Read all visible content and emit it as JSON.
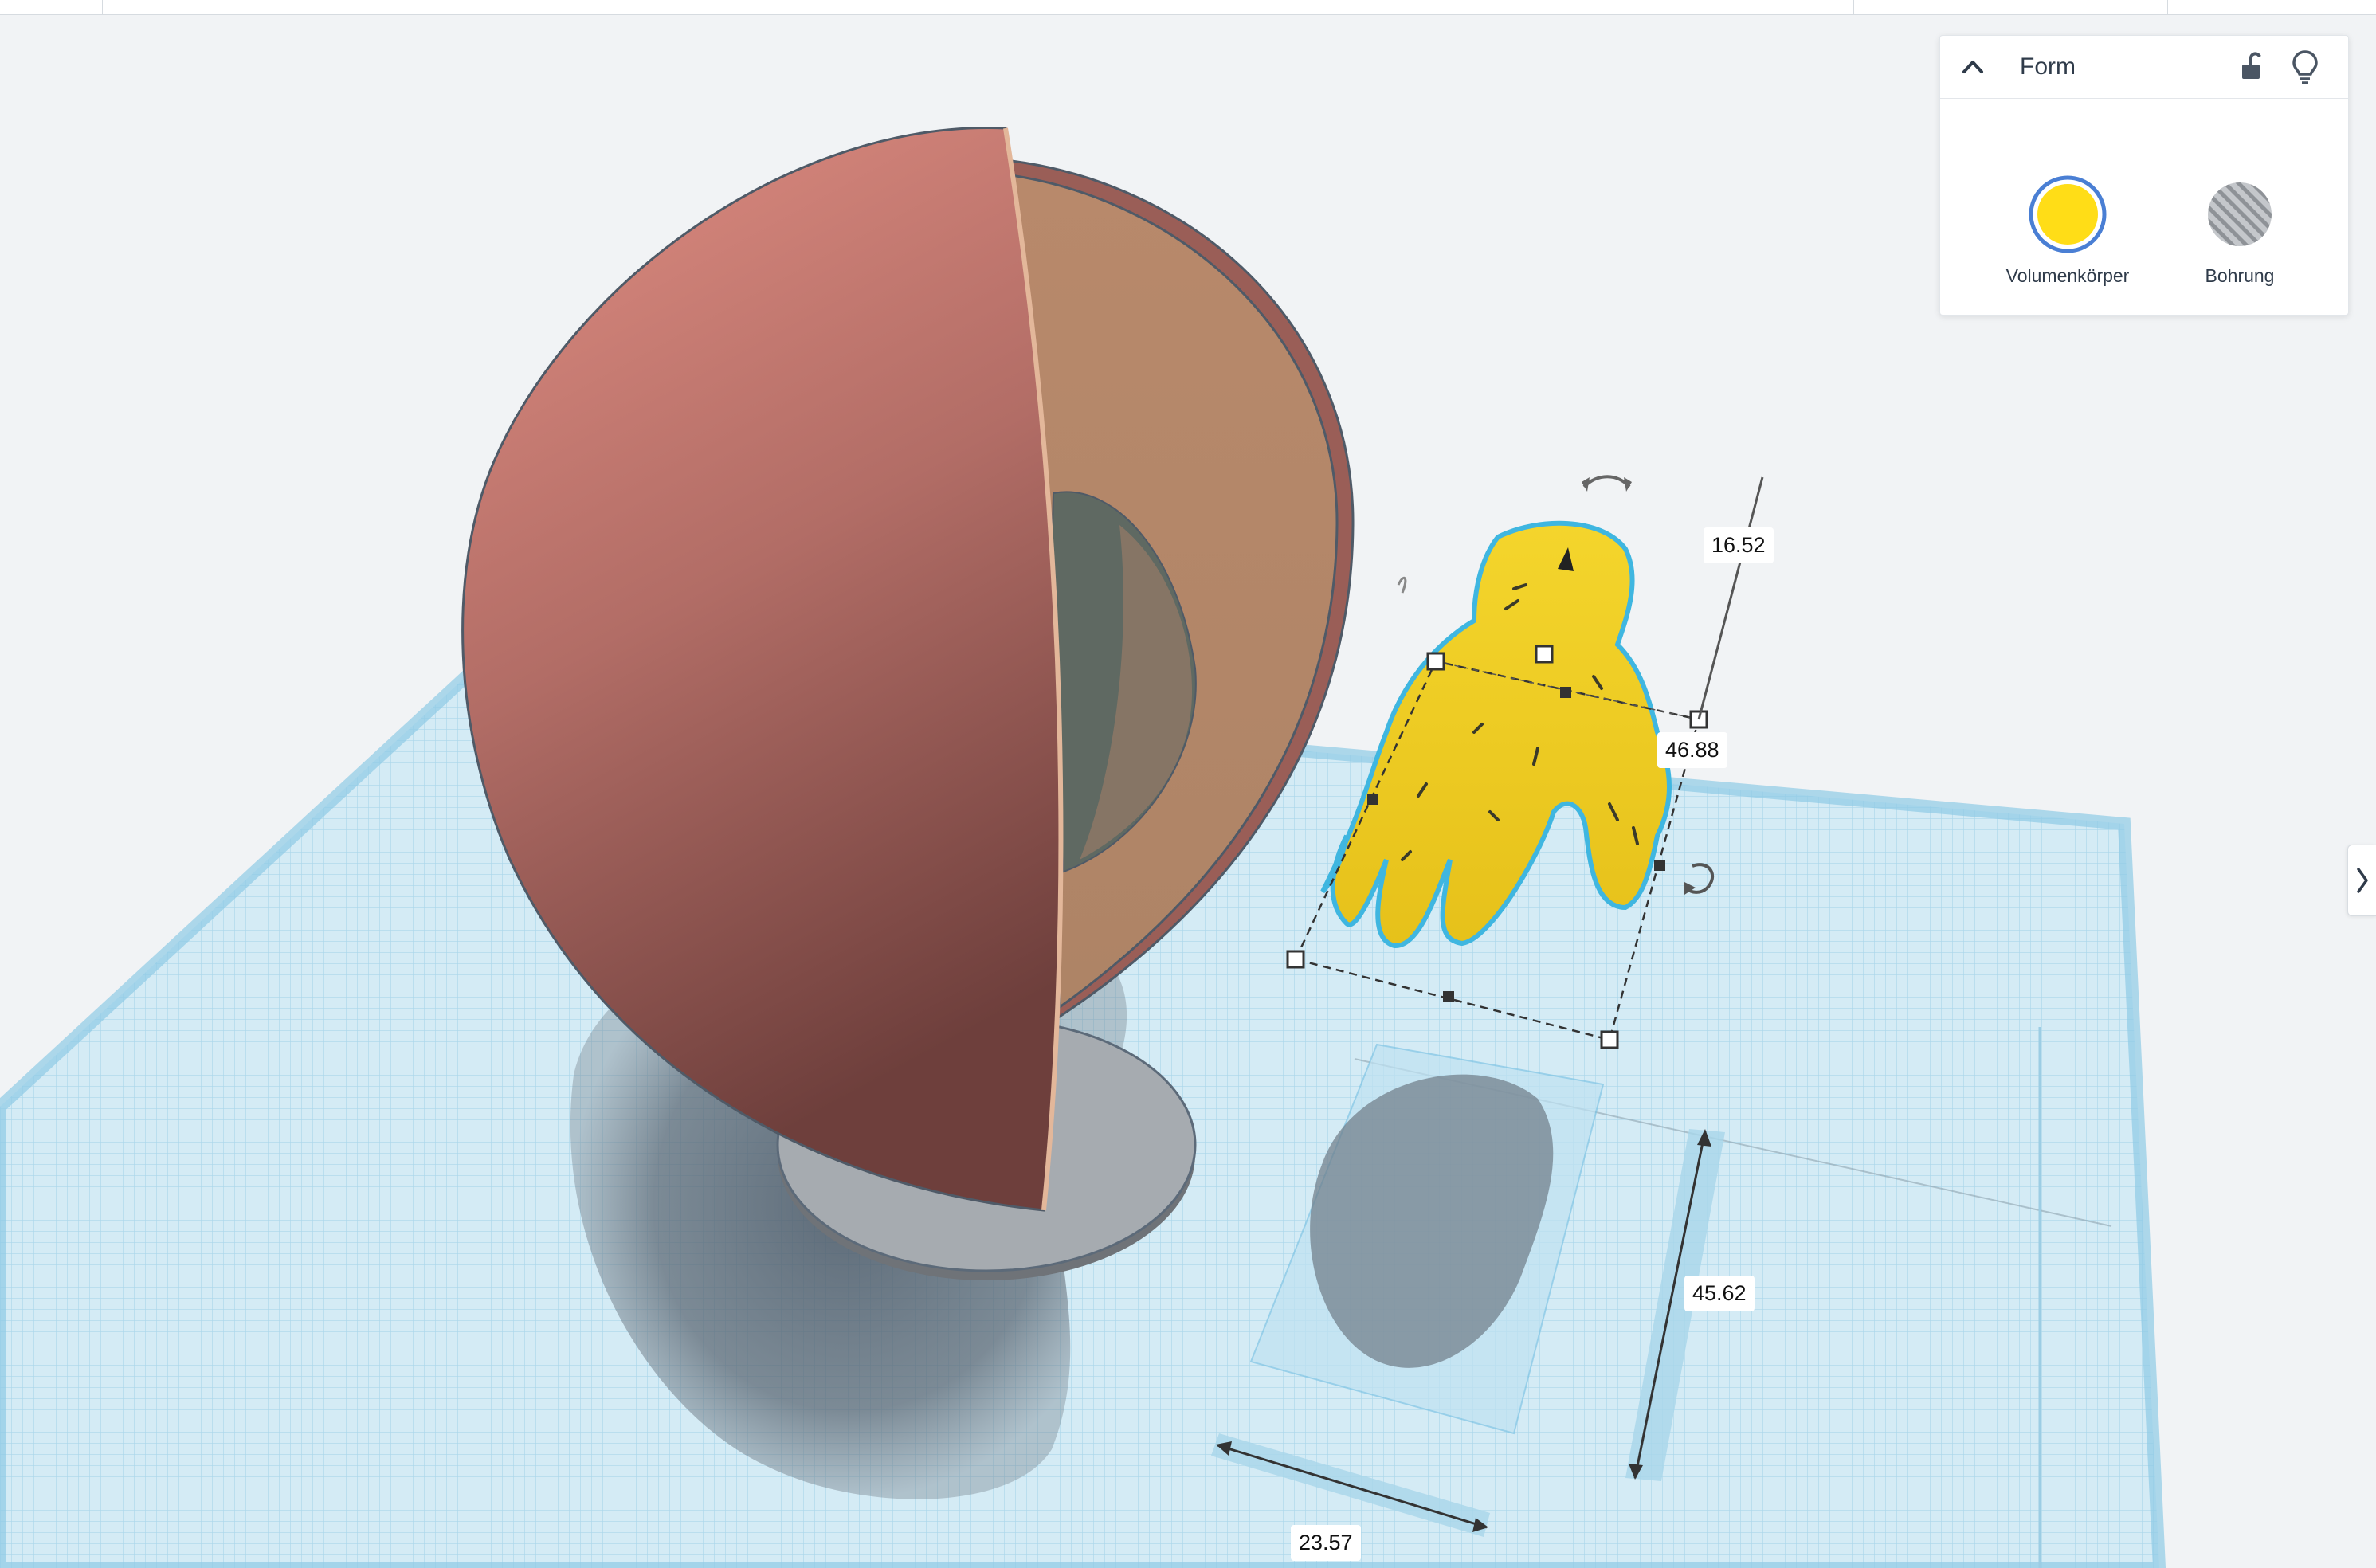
{
  "inspector": {
    "title": "Form",
    "options": [
      {
        "label": "Volumenkörper",
        "color": "#FFDD17",
        "selected": true
      },
      {
        "label": "Bohrung",
        "pattern": "hatched-gray",
        "selected": false
      }
    ]
  },
  "dimensions": {
    "height": "16.52",
    "width": "46.88",
    "length": "45.62",
    "depth": "23.57"
  },
  "colors": {
    "workplane": "#cde6f2",
    "grid_line": "#9fcfe6",
    "sphere_outer": "#c97d73",
    "sphere_cut_face": "#b48a6c",
    "stand": "#9ea3a8",
    "hand": "#f2d12a",
    "hand_outline": "#3fb6e0",
    "selection_accent": "#4a7fd4"
  },
  "icons": {
    "collapse": "chevron-up-icon",
    "lock": "lock-icon",
    "bulb": "light-bulb-icon",
    "rotate": "rotate-arrow-icon",
    "expand_panel": "chevron-right-icon"
  }
}
